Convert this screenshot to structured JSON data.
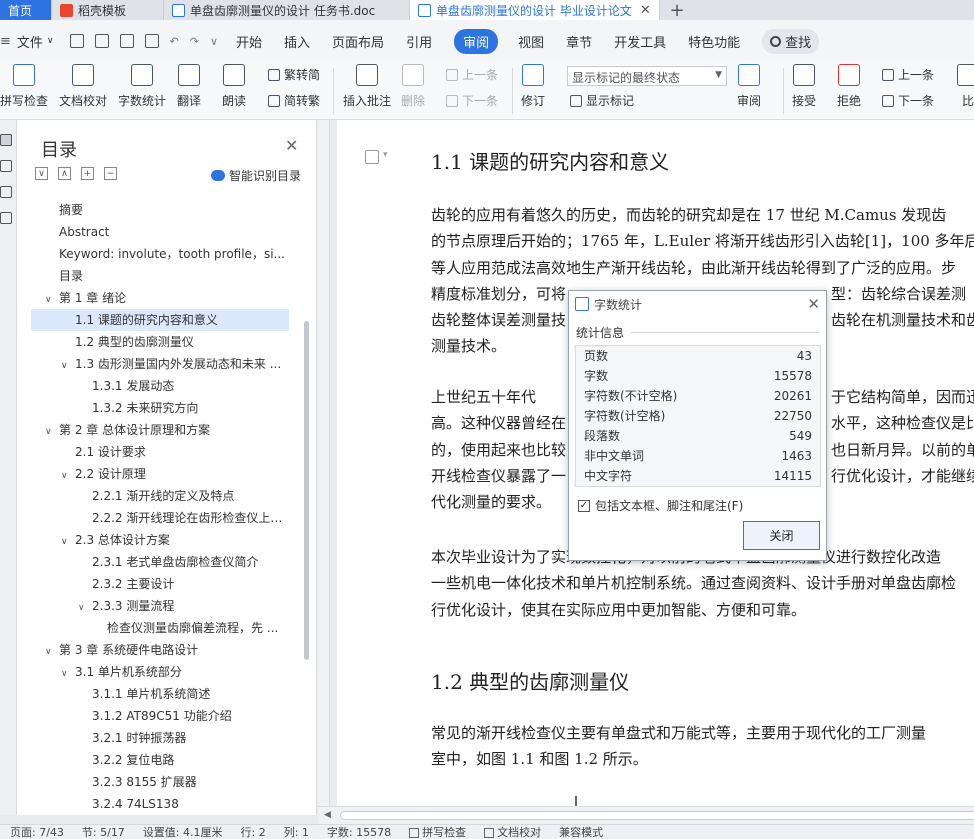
{
  "tabs": [
    {
      "label": "首页"
    },
    {
      "label": "稻壳模板"
    },
    {
      "label": "单盘齿廓测量仪的设计 任务书.doc"
    },
    {
      "label": "单盘齿廓测量仪的设计 毕业设计论文"
    }
  ],
  "menu": {
    "file": "文件",
    "items": [
      "开始",
      "插入",
      "页面布局",
      "引用",
      "审阅",
      "视图",
      "章节",
      "开发工具",
      "特色功能"
    ],
    "active": "审阅",
    "search": "查找"
  },
  "ribbon": {
    "spellcheck": "拼写检查",
    "doc_proof": "文档校对",
    "word_count": "字数统计",
    "translate": "翻译",
    "read_aloud": "朗读",
    "trad_to_simp": "繁转简",
    "simp_to_trad": "简转繁",
    "insert_comment": "插入批注",
    "delete": "删除",
    "prev_item": "上一条",
    "next_item": "下一条",
    "track_changes": "修订",
    "markup_select": "显示标记的最终状态",
    "show_markup": "显示标记",
    "review": "审阅",
    "accept": "接受",
    "reject": "拒绝",
    "prev": "上一条",
    "next": "下一条",
    "compare": "比"
  },
  "toc": {
    "title": "目录",
    "smart": "智能识别目录",
    "items": [
      {
        "label": "摘要",
        "level": "l1",
        "arrow": ""
      },
      {
        "label": "Abstract",
        "level": "l1",
        "arrow": ""
      },
      {
        "label": "Keyword: involute，tooth profile，si...",
        "level": "l1",
        "arrow": ""
      },
      {
        "label": "目录",
        "level": "l1",
        "arrow": ""
      },
      {
        "label": "第 1 章  绪论",
        "level": "l0h",
        "arrow": "∨"
      },
      {
        "label": "1.1  课题的研究内容和意义",
        "level": "l2",
        "arrow": "",
        "selected": true
      },
      {
        "label": "1.2  典型的齿廓测量仪",
        "level": "l2",
        "arrow": ""
      },
      {
        "label": "1.3  齿形测量国内外发展动态和未来 ...",
        "level": "l2a",
        "arrow": "∨"
      },
      {
        "label": "1.3.1 发展动态",
        "level": "l3",
        "arrow": ""
      },
      {
        "label": "1.3.2 未来研究方向",
        "level": "l3",
        "arrow": ""
      },
      {
        "label": "第 2 章  总体设计原理和方案",
        "level": "l0h",
        "arrow": "∨"
      },
      {
        "label": "2.1 设计要求",
        "level": "l2",
        "arrow": ""
      },
      {
        "label": "2.2 设计原理",
        "level": "l2a",
        "arrow": "∨"
      },
      {
        "label": "2.2.1 渐开线的定义及特点",
        "level": "l3",
        "arrow": ""
      },
      {
        "label": "2.2.2 渐开线理论在齿形检查仪上 ...",
        "level": "l3",
        "arrow": ""
      },
      {
        "label": "2.3 总体设计方案",
        "level": "l2a",
        "arrow": "∨"
      },
      {
        "label": "2.3.1 老式单盘齿廓检查仪简介",
        "level": "l3",
        "arrow": ""
      },
      {
        "label": "2.3.2 主要设计",
        "level": "l3",
        "arrow": ""
      },
      {
        "label": "2.3.3 测量流程",
        "level": "l3a",
        "arrow": "∨"
      },
      {
        "label": "检查仪测量齿廓偏差流程，先 ...",
        "level": "l4",
        "arrow": ""
      },
      {
        "label": "第 3 章  系统硬件电路设计",
        "level": "l0h",
        "arrow": "∨"
      },
      {
        "label": "3.1 单片机系统部分",
        "level": "l2a",
        "arrow": "∨"
      },
      {
        "label": "3.1.1 单片机系统简述",
        "level": "l3",
        "arrow": ""
      },
      {
        "label": "3.1.2 AT89C51 功能介绍",
        "level": "l3",
        "arrow": ""
      },
      {
        "label": "3.2.1 时钟振荡器",
        "level": "l3",
        "arrow": ""
      },
      {
        "label": "3.2.2 复位电路",
        "level": "l3",
        "arrow": ""
      },
      {
        "label": "3.2.3 8155 扩展器",
        "level": "l3",
        "arrow": ""
      },
      {
        "label": "3.2.4 74LS138",
        "level": "l3",
        "arrow": ""
      }
    ]
  },
  "document": {
    "heading1": "1.1  课题的研究内容和意义",
    "para1": [
      "    齿轮的应用有着悠久的历史，而齿轮的研究却是在 17 世纪 M.Camus 发现齿",
      "的节点原理后开始的；1765 年，L.Euler 将渐开线齿形引入齿轮[1]，100 多年后，",
      "等人应用范成法高效地生产渐开线齿轮，由此渐开线齿轮得到了广泛的应用。步",
      "精度标准划分，可将",
      "齿轮整体误差测量技",
      "测量技术。"
    ],
    "para1_right": [
      "型：齿轮综合误差测",
      "齿轮在机测量技术和齿"
    ],
    "para2": [
      "    上世纪五十年代",
      "高。这种仪器曾经在",
      "的，使用起来也比较",
      "开线检查仪暴露了一",
      "代化测量的要求。"
    ],
    "para2_right": [
      "于它结构简单，因而迅",
      "水平，这种检查仪是比",
      "也日新月异。以前的单",
      "行优化设计，才能继续"
    ],
    "para3": [
      "    本次毕业设计为了实现数控化，对以前的老式单盘齿廓测量仪进行数控化改造",
      "一些机电一体化技术和单片机控制系统。通过查阅资料、设计手册对单盘齿廓检",
      "行优化设计，使其在实际应用中更加智能、方便和可靠。"
    ],
    "heading2": "1.2  典型的齿廓测量仪",
    "para4": [
      "    常见的渐开线检查仪主要有单盘式和万能式等，主要用于现代化的工厂测量",
      "室中，如图 1.1 和图 1.2 所示。"
    ]
  },
  "dialog": {
    "title": "字数统计",
    "group": "统计信息",
    "stats": [
      {
        "label": "页数",
        "value": "43"
      },
      {
        "label": "字数",
        "value": "15578"
      },
      {
        "label": "字符数(不计空格)",
        "value": "20261"
      },
      {
        "label": "字符数(计空格)",
        "value": "22750"
      },
      {
        "label": "段落数",
        "value": "549"
      },
      {
        "label": "非中文单词",
        "value": "1463"
      },
      {
        "label": "中文字符",
        "value": "14115"
      }
    ],
    "include_label": "包括文本框、脚注和尾注(F)",
    "include_checked": true,
    "close": "关闭"
  },
  "statusbar": {
    "page": "页面: 7/43",
    "section": "节: 5/17",
    "setting": "设置值: 4.1厘米",
    "row": "行: 2",
    "col": "列: 1",
    "wordcount": "字数: 15578",
    "spell": "拼写检查",
    "proof": "文档校对",
    "compat": "兼容模式"
  }
}
